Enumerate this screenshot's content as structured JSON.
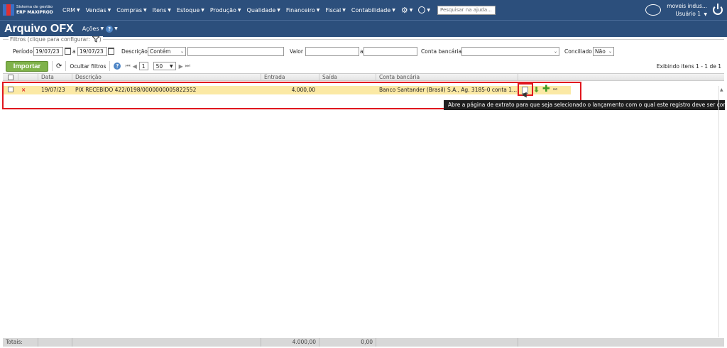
{
  "app": {
    "logo_line1": "Sistema de gestão",
    "logo_line2": "ERP MAXIPROD",
    "menu": [
      "CRM",
      "Vendas",
      "Compras",
      "Itens",
      "Estoque",
      "Produção",
      "Qualidade",
      "Financeiro",
      "Fiscal",
      "Contabilidade"
    ],
    "help_placeholder": "Pesquisar na ajuda...",
    "company": "moveis indus...",
    "user": "Usuário 1"
  },
  "page": {
    "title": "Arquivo OFX",
    "actions_label": "Ações"
  },
  "filters": {
    "legend": "Filtros (clique para configurar:",
    "period_label": "Período",
    "date_from": "19/07/23",
    "date_sep": "a",
    "date_to": "19/07/23",
    "description_label": "Descrição",
    "description_mode": "Contém",
    "description_value": "",
    "value_label": "Valor",
    "value_from": "",
    "value_sep": "a",
    "value_to": "",
    "bank_account_label": "Conta bancária",
    "bank_account_value": "",
    "reconciled_label": "Conciliado",
    "reconciled_value": "Não"
  },
  "toolbar": {
    "import_label": "Importar",
    "hide_filters_label": "Ocultar filtros",
    "page_number": "1",
    "page_size": "50",
    "showing": "Exibindo itens 1 - 1 de 1"
  },
  "grid": {
    "columns": [
      "Data",
      "Descrição",
      "Entrada",
      "Saída",
      "Conta bancária"
    ],
    "rows": [
      {
        "status": "×",
        "date": "19/07/23",
        "description": "PIX RECEBIDO 422/0198/0000000005822552",
        "entrada": "4.000,00",
        "saida": "",
        "bank_account": "Banco Santander (Brasil) S.A., Ag. 3185-0 conta 1..."
      }
    ]
  },
  "tooltip": "Abre a página de extrato para que seja selecionado o lançamento com o qual este registro deve ser conciliado",
  "totals": {
    "label": "Totais:",
    "entrada": "4.000,00",
    "saida": "0,00"
  },
  "colors": {
    "nav_bg": "#2c4f7c",
    "import_green": "#7fb24a",
    "row_highlight": "#fbe9a5",
    "annotation_red": "#e0161e"
  }
}
